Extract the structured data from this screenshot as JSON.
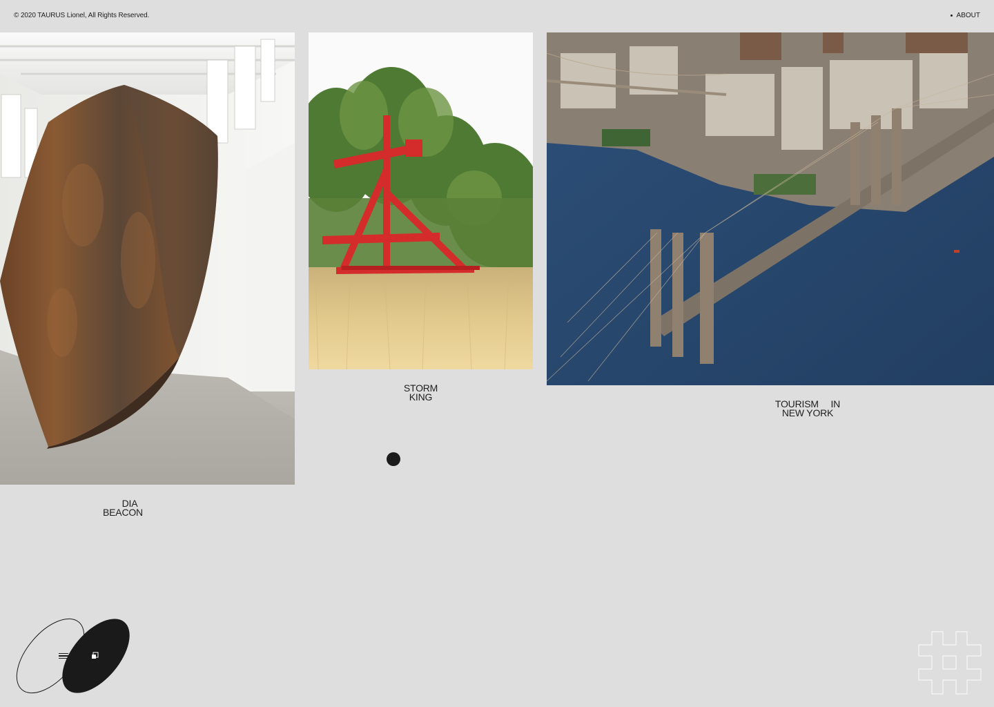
{
  "header": {
    "copyright": "© 2020 TAURUS Lionel, All Rights Reserved.",
    "about_label": "ABOUT"
  },
  "projects": [
    {
      "caption_line1": "DIA",
      "caption_line2": "BEACON",
      "image": "rusted-steel-sculpture-gallery"
    },
    {
      "caption_line1": "STORM",
      "caption_line2": "KING",
      "image": "red-steel-sculpture-field"
    },
    {
      "caption_line1": "TOURISM IN",
      "caption_line2": "NEW YORK",
      "image": "brooklyn-bridge-aerial"
    }
  ],
  "icons": {
    "menu": "hamburger-icon",
    "window": "window-icon",
    "logo": "hash-logo-icon"
  },
  "colors": {
    "background": "#dededf",
    "ink": "#1a1a1a"
  }
}
